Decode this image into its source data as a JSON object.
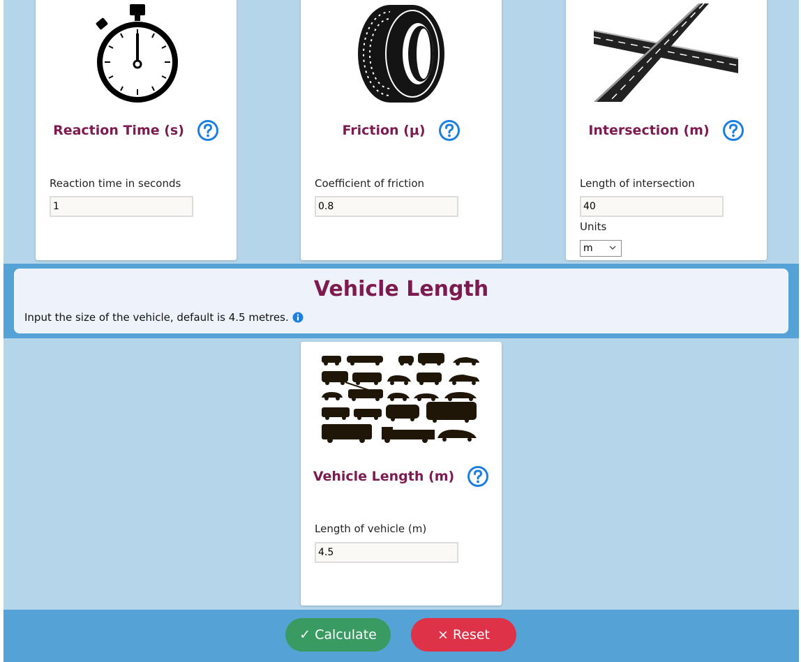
{
  "cards": {
    "reaction": {
      "title": "Reaction Time (s)",
      "label": "Reaction time in seconds",
      "value": "1",
      "icon": "stopwatch-icon"
    },
    "friction": {
      "title": "Friction (μ)",
      "label": "Coefficient of friction",
      "value": "0.8",
      "icon": "tyre-icon"
    },
    "intersection": {
      "title": "Intersection (m)",
      "label": "Length of intersection",
      "value": "40",
      "units_label": "Units",
      "units_value": "m",
      "icon": "intersection-road-icon"
    },
    "vehicle": {
      "title": "Vehicle Length (m)",
      "label": "Length of vehicle (m)",
      "value": "4.5",
      "icon": "vehicles-silhouette-icon"
    }
  },
  "vehicle_section": {
    "heading": "Vehicle Length",
    "description": "Input the size of the vehicle, default is 4.5 metres."
  },
  "footer": {
    "calculate_label": "✓ Calculate",
    "reset_label": "× Reset"
  },
  "colors": {
    "background": "#b5d5ea",
    "band": "#55a3d6",
    "title": "#7d1a4f",
    "help": "#1a7fe0",
    "calculate": "#3a9b62",
    "reset": "#dd3247"
  }
}
